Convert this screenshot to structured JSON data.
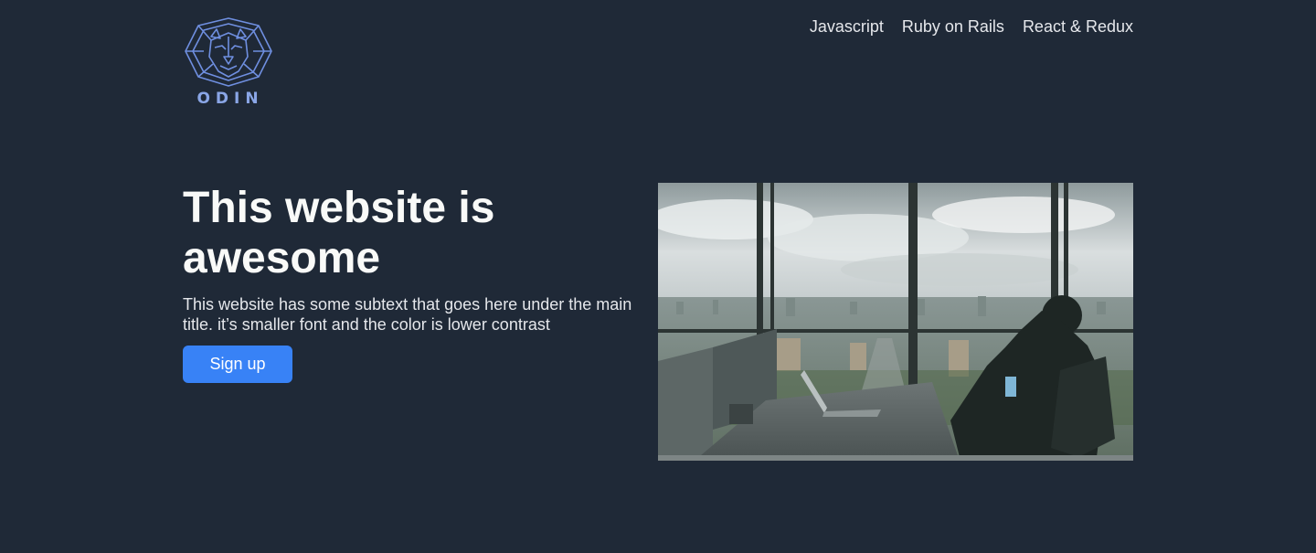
{
  "header": {
    "logo": {
      "icon": "lion-head-logo-icon",
      "text": "ODIN"
    },
    "nav": [
      {
        "label": "Javascript"
      },
      {
        "label": "Ruby on Rails"
      },
      {
        "label": "React & Redux"
      }
    ]
  },
  "hero": {
    "title": "This website is awesome",
    "subtitle": "This website has some subtext that goes here under the main title. it’s smaller font and the color is lower contrast",
    "signup_label": "Sign up",
    "image": {
      "icon": "office-photo"
    }
  },
  "colors": {
    "background": "#1f2937",
    "accent": "#3882f6",
    "heading": "#f9faf8",
    "subtext": "#e5e7eb",
    "logo": "#8aa6e6"
  }
}
